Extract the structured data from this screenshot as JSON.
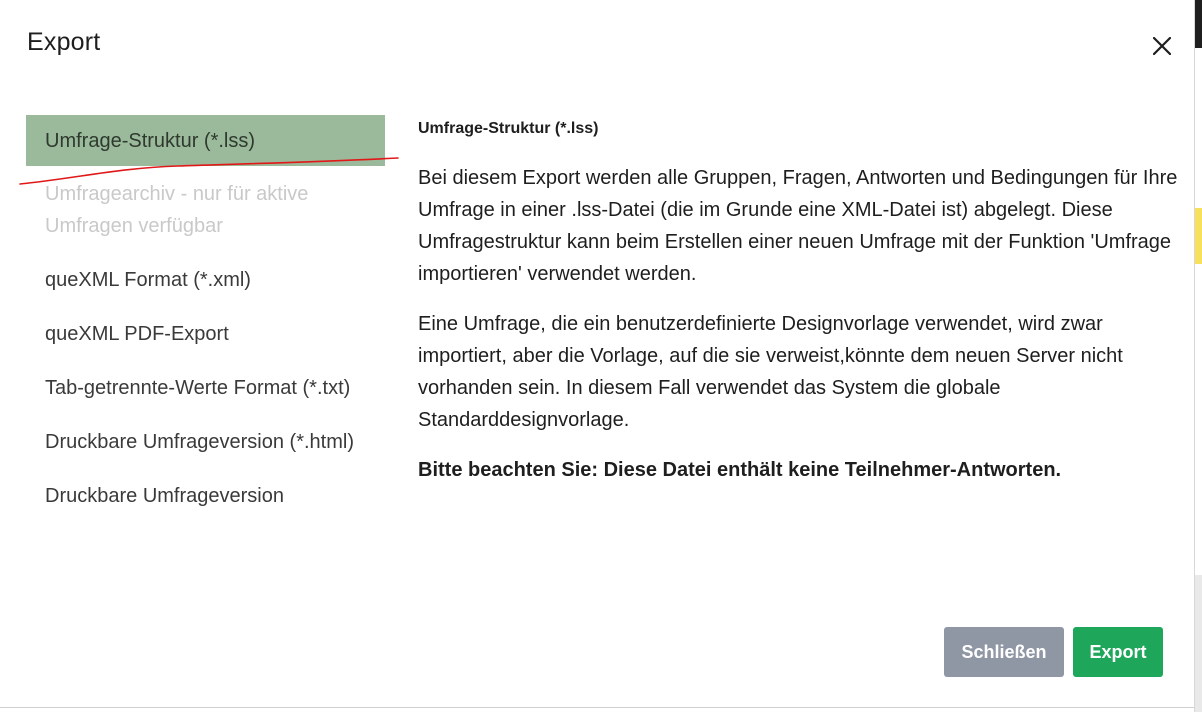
{
  "modal": {
    "title": "Export",
    "close_icon": "close-icon"
  },
  "nav": {
    "items": [
      {
        "label": "Umfrage-Struktur (*.lss)",
        "state": "active"
      },
      {
        "label": "Umfragearchiv - nur für aktive Umfragen verfügbar",
        "state": "disabled"
      },
      {
        "label": "queXML Format (*.xml)",
        "state": "normal"
      },
      {
        "label": "queXML PDF-Export",
        "state": "normal"
      },
      {
        "label": "Tab-getrennte-Werte Format (*.txt)",
        "state": "normal"
      },
      {
        "label": "Druckbare Umfrageversion (*.html)",
        "state": "normal"
      },
      {
        "label": "Druckbare Umfrageversion",
        "state": "normal"
      }
    ]
  },
  "content": {
    "heading": "Umfrage-Struktur (*.lss)",
    "paragraph1": "Bei diesem Export werden alle Gruppen, Fragen, Antworten und Bedingungen für Ihre Umfrage in einer .lss-Datei (die im Grunde eine XML-Datei ist) abgelegt. Diese Umfragestruktur kann beim Erstellen einer neuen Umfrage mit der Funktion 'Umfrage importieren' verwendet werden.",
    "paragraph2": "Eine Umfrage, die ein benutzerdefinierte Designvorlage verwendet, wird zwar importiert, aber die Vorlage, auf die sie verweist,könnte dem neuen Server nicht vorhanden sein. In diesem Fall verwendet das System die globale Standarddesignvorlage.",
    "note": "Bitte beachten Sie: Diese Datei enthält keine Teilnehmer-Antworten."
  },
  "footer": {
    "close_label": "Schließen",
    "export_label": "Export"
  },
  "colors": {
    "active_item_bg": "#9bba9b",
    "close_button_bg": "#8f96a4",
    "export_button_bg": "#1ea75a",
    "annotation_stroke": "#e01818"
  }
}
